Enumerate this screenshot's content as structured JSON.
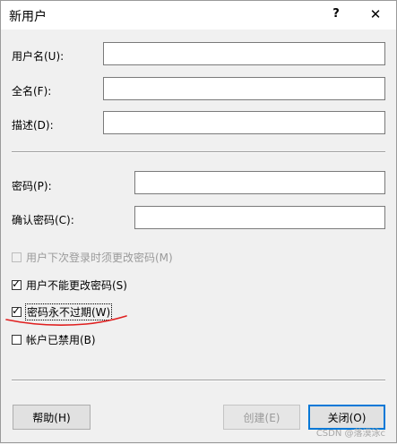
{
  "window": {
    "title": "新用户",
    "help_glyph": "?",
    "close_glyph": "✕"
  },
  "fields": {
    "username_label": "用户名(U):",
    "username_value": "",
    "fullname_label": "全名(F):",
    "fullname_value": "",
    "description_label": "描述(D):",
    "description_value": "",
    "password_label": "密码(P):",
    "password_value": "",
    "confirm_label": "确认密码(C):",
    "confirm_value": ""
  },
  "options": {
    "must_change": {
      "label": "用户下次登录时须更改密码(M)",
      "checked": false,
      "enabled": false
    },
    "cannot_change": {
      "label": "用户不能更改密码(S)",
      "checked": true,
      "enabled": true
    },
    "never_expires": {
      "label": "密码永不过期(W)",
      "checked": true,
      "enabled": true
    },
    "disabled_account": {
      "label": "帐户已禁用(B)",
      "checked": false,
      "enabled": true
    }
  },
  "buttons": {
    "help": "帮助(H)",
    "create": "创建(E)",
    "close": "关闭(O)"
  },
  "annotation_color": "#e02020",
  "watermark": "CSDN @落漠泳c"
}
